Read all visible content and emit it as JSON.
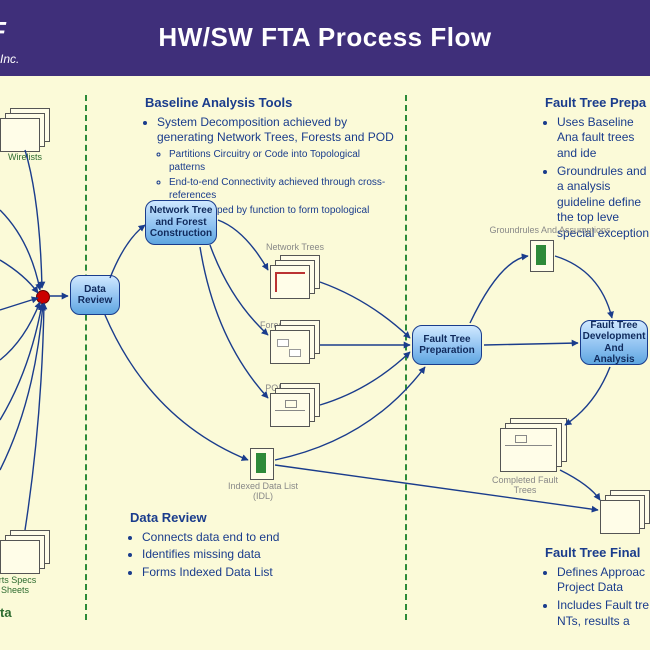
{
  "title": "HW/SW FTA Process Flow",
  "company_suffix": "Inc.",
  "sections": {
    "baseline": {
      "heading": "Baseline Analysis Tools",
      "bullets": [
        "System Decomposition achieved by generating Network Trees, Forests and POD"
      ],
      "sub_bullets": [
        "Partitions Circuitry or Code into Topological patterns",
        "End-to-end Connectivity achieved through cross-references",
        "Trees grouped by function to form topological forest"
      ]
    },
    "ft_prep": {
      "heading": "Fault Tree Prepa",
      "bullets": [
        "Uses Baseline Ana fault trees and ide",
        "Groundrules and a analysis guideline define the top leve special exception"
      ]
    },
    "data_review": {
      "heading": "Data Review",
      "bullets": [
        "Connects data end to end",
        "Identifies missing data",
        "Forms Indexed Data List"
      ]
    },
    "ft_final": {
      "heading": "Fault Tree Final",
      "bullets": [
        "Defines Approac Project Data",
        "Includes Fault tre NTs, results a"
      ]
    }
  },
  "proc": {
    "data_review": "Data Review",
    "nt_forest": "Network Tree and Forest Construction",
    "ft_prep": "Fault Tree Preparation",
    "ft_dev": "Fault Tree Development And Analysis"
  },
  "labels": {
    "wirelists": "Wirelists",
    "parts_specs": "arts Specs Sheets",
    "data_footer": "ta",
    "network_trees": "Network Trees",
    "forests": "Forests",
    "pod": "POD",
    "idl": "Indexed Data List (IDL)",
    "groundrules": "Groundrules And Assumptions",
    "completed_ft": "Completed Fault Trees"
  }
}
